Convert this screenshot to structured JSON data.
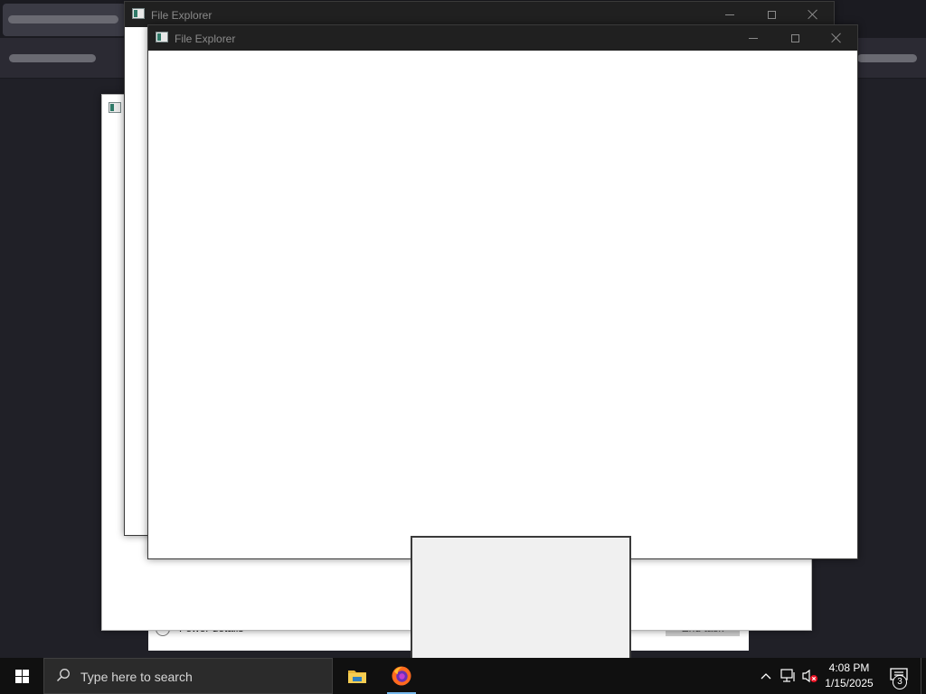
{
  "background": {
    "colors": {
      "page": "#202027",
      "tab": "#3b3b45",
      "toolbar": "#2b2a33"
    }
  },
  "dialog_back": {
    "radio_label": "Fewer details",
    "button_label": "End task"
  },
  "windows": [
    {
      "title": "File Explorer",
      "icon": "file-explorer-icon"
    },
    {
      "title": "File Explorer",
      "icon": "file-explorer-icon"
    }
  ],
  "window_controls": {
    "minimize": "minimize-icon",
    "maximize": "maximize-icon",
    "close": "close-icon"
  },
  "taskbar": {
    "search_placeholder": "Type here to search",
    "apps": [
      {
        "name": "File Explorer",
        "icon": "folder-icon",
        "active": false
      },
      {
        "name": "Firefox",
        "icon": "firefox-icon",
        "active": true
      }
    ],
    "clock": {
      "time": "4:08 PM",
      "date": "1/15/2025"
    },
    "notification_count": "3",
    "colors": {
      "bar": "#101010",
      "active": "#76b9ed",
      "muted": "#e81123"
    }
  }
}
